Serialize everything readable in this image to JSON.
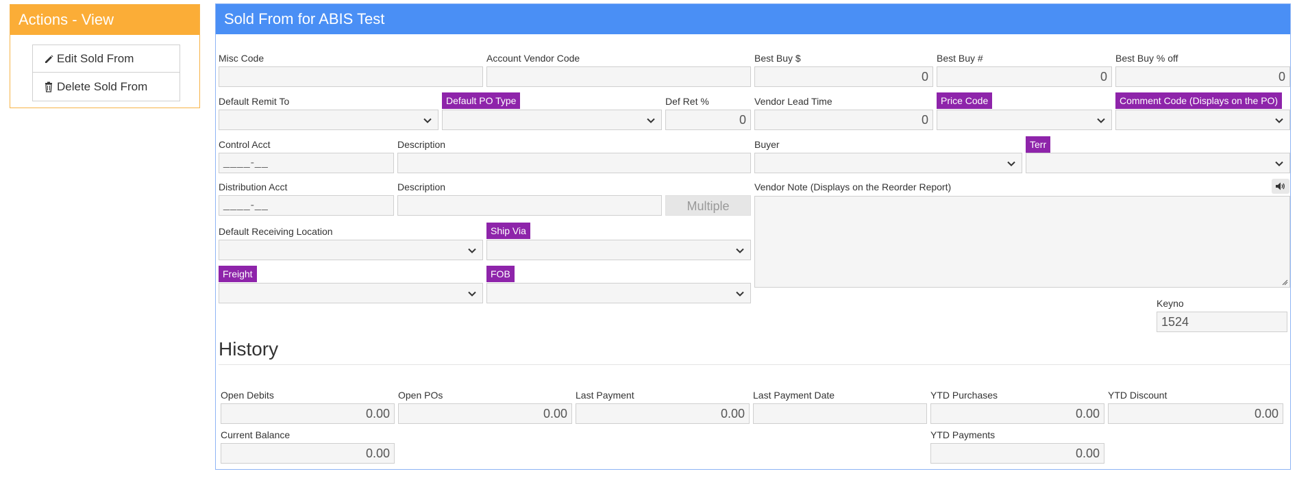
{
  "actions": {
    "title": "Actions - View",
    "edit_label": "Edit Sold From",
    "delete_label": "Delete Sold From"
  },
  "page": {
    "title": "Sold From for ABIS Test"
  },
  "form": {
    "misc_code": {
      "label": "Misc Code",
      "value": ""
    },
    "account_vendor_code": {
      "label": "Account Vendor Code",
      "value": ""
    },
    "best_buy_dollar": {
      "label": "Best Buy $",
      "value": "0"
    },
    "best_buy_num": {
      "label": "Best Buy #",
      "value": "0"
    },
    "best_buy_pct": {
      "label": "Best Buy % off",
      "value": "0"
    },
    "default_remit_to": {
      "label": "Default Remit To",
      "value": ""
    },
    "default_po_type": {
      "label": "Default PO Type",
      "value": ""
    },
    "def_ret_pct": {
      "label": "Def Ret %",
      "value": "0"
    },
    "vendor_lead_time": {
      "label": "Vendor Lead Time",
      "value": "0"
    },
    "price_code": {
      "label": "Price Code",
      "value": ""
    },
    "comment_code": {
      "label": "Comment Code (Displays on the PO)",
      "value": ""
    },
    "control_acct": {
      "label": "Control Acct",
      "value": "____-__"
    },
    "control_desc": {
      "label": "Description",
      "value": ""
    },
    "buyer": {
      "label": "Buyer",
      "value": ""
    },
    "terr": {
      "label": "Terr",
      "value": ""
    },
    "distribution_acct": {
      "label": "Distribution Acct",
      "value": "____-__"
    },
    "distribution_desc": {
      "label": "Description",
      "value": ""
    },
    "multiple_label": "Multiple",
    "vendor_note": {
      "label": "Vendor Note (Displays on the Reorder Report)",
      "value": ""
    },
    "default_receiving_location": {
      "label": "Default Receiving Location",
      "value": ""
    },
    "ship_via": {
      "label": "Ship Via",
      "value": ""
    },
    "freight": {
      "label": "Freight",
      "value": ""
    },
    "fob": {
      "label": "FOB",
      "value": ""
    },
    "keyno": {
      "label": "Keyno",
      "value": "1524"
    }
  },
  "history": {
    "title": "History",
    "open_debits": {
      "label": "Open Debits",
      "value": "0.00"
    },
    "open_pos": {
      "label": "Open POs",
      "value": "0.00"
    },
    "last_payment": {
      "label": "Last Payment",
      "value": "0.00"
    },
    "last_payment_date": {
      "label": "Last Payment Date",
      "value": ""
    },
    "ytd_purchases": {
      "label": "YTD Purchases",
      "value": "0.00"
    },
    "ytd_discount": {
      "label": "YTD Discount",
      "value": "0.00"
    },
    "current_balance": {
      "label": "Current Balance",
      "value": "0.00"
    },
    "ytd_payments": {
      "label": "YTD Payments",
      "value": "0.00"
    }
  },
  "colors": {
    "actions_header": "#fbad37",
    "main_header": "#4a8ff5",
    "tag_purple": "#8e24aa"
  },
  "icons": {
    "edit": "pencil-icon",
    "delete": "trash-icon",
    "select": "chevron-down-icon",
    "speaker": "speaker-icon"
  }
}
